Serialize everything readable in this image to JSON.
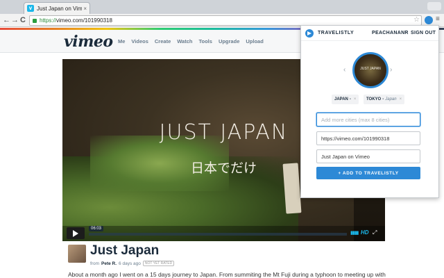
{
  "browser": {
    "tab_title": "Just Japan on Vimeo",
    "tab_close": "×",
    "url_scheme": "https://",
    "url_rest": "vimeo.com/101990318",
    "back": "←",
    "forward": "→",
    "reload": "C",
    "star": "☆",
    "menu": "≡"
  },
  "vimeo": {
    "logo": "vimeo",
    "nav": [
      "Me",
      "Videos",
      "Create",
      "Watch",
      "Tools",
      "Upgrade",
      "Upload"
    ],
    "video": {
      "title_overlay": "JUST JAPAN",
      "subtitle_overlay": "日本でだけ",
      "timecode": "06:03",
      "progress": 0.0,
      "hd": "HD"
    },
    "info": {
      "title": "Just Japan",
      "from": "from",
      "author": "Pete R.",
      "age": "6 days ago",
      "rating": "NOT YET RATED",
      "description": "About a month ago I went on a 15 days journey to Japan. From summiting the Mt Fuji during a typhoon to meeting up with an old"
    }
  },
  "popup": {
    "brand": "TRAVELISTLY",
    "user": "PEACHANANR",
    "signout": "SIGN OUT",
    "chev_left": "‹",
    "chev_right": "›",
    "thumb_text": "JUST JAPAN",
    "chips": [
      {
        "label": "JAPAN",
        "sub": "",
        "x": "×"
      },
      {
        "label": "TOKYO",
        "sub": "Japan",
        "x": "×"
      }
    ],
    "cities_placeholder": "Add more cities (max 8 cities)",
    "url_value": "https://vimeo.com/101990318",
    "title_value": "Just Japan on Vimeo",
    "add_button": "+ ADD TO TRAVELISTLY"
  },
  "colors": {
    "accent": "#2d89d6",
    "vimeo_blue": "#1ab7ea"
  }
}
